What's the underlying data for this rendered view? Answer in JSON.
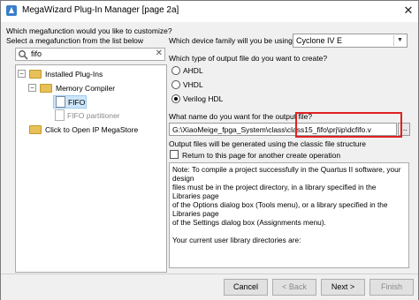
{
  "window": {
    "title": "MegaWizard Plug-In Manager [page 2a]",
    "close_glyph": "✕"
  },
  "left": {
    "question": "Which megafunction would you like to customize?",
    "instruction": "Select a megafunction from the list below",
    "search": {
      "value": "fifo",
      "clear_glyph": "✕"
    },
    "tree": {
      "installed": "Installed Plug-Ins",
      "memory_compiler": "Memory Compiler",
      "fifo": "FIFO",
      "fifo_partitioner": "FIFO partitioner",
      "megastore": "Click to Open IP MegaStore",
      "expander_minus": "−",
      "expander_plus": "+"
    }
  },
  "right": {
    "device_family_label": "Which device family will you be using?",
    "device_family_value": "Cyclone IV E",
    "output_type_label": "Which type of output file do you want to create?",
    "options": [
      "AHDL",
      "VHDL",
      "Verilog HDL"
    ],
    "selected_option": "Verilog HDL",
    "output_name_label": "What name do you want for the output file?",
    "output_path": "G:\\XiaoMeige_fpga_System\\class\\class15_fifo\\prj\\ip\\dcfifo.v",
    "browse_label": "...",
    "classic_note": "Output files will be generated using the classic file structure",
    "return_label": "Return to this page for another create operation",
    "note_lines": [
      "Note: To compile a project successfully in the Quartus II software, your design",
      "files must be in the project directory, in a library specified in the Libraries page",
      "of the Options dialog box (Tools menu), or a library specified in the Libraries page",
      "of the Settings dialog box (Assignments menu).",
      "",
      "Your current user library directories are:"
    ]
  },
  "buttons": {
    "cancel": "Cancel",
    "back": "< Back",
    "next": "Next >",
    "finish": "Finish"
  }
}
